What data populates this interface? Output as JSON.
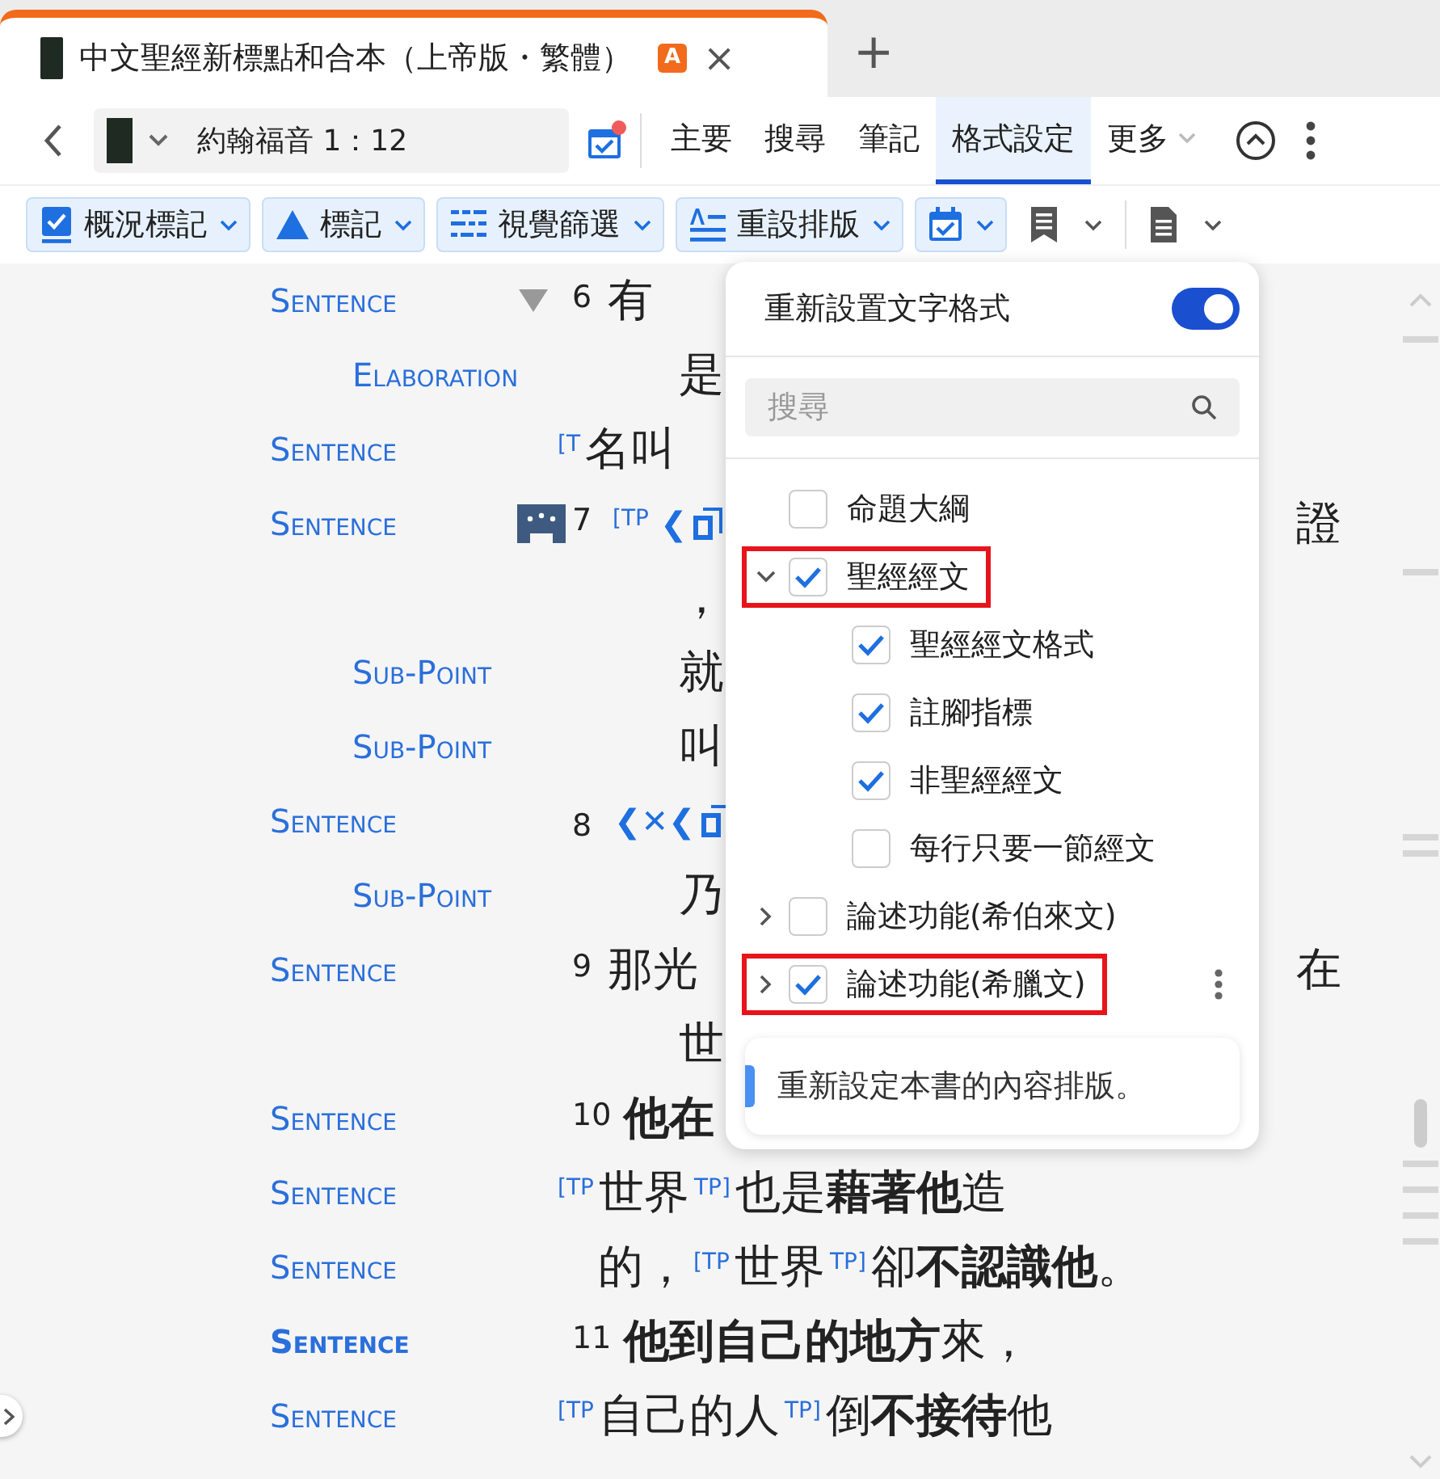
{
  "tab": {
    "title": "中文聖經新標點和合本（上帝版・繁體）",
    "badge": "A",
    "close": "×",
    "add": "+"
  },
  "nav": {
    "reference": "約翰福音 1：12",
    "tabs": [
      {
        "label": "主要",
        "selected": false,
        "dropdown": false
      },
      {
        "label": "搜尋",
        "selected": false,
        "dropdown": false
      },
      {
        "label": "筆記",
        "selected": false,
        "dropdown": false
      },
      {
        "label": "格式設定",
        "selected": true,
        "dropdown": false
      },
      {
        "label": "更多",
        "selected": false,
        "dropdown": true
      }
    ]
  },
  "toolbar": [
    {
      "label": "概況標記",
      "kind": "chip"
    },
    {
      "label": "標記",
      "kind": "chip"
    },
    {
      "label": "視覺篩選",
      "kind": "chip"
    },
    {
      "label": "重設排版",
      "kind": "chip"
    },
    {
      "kind": "chip"
    },
    {
      "kind": "plain"
    },
    {
      "kind": "plain"
    }
  ],
  "rows": [
    {
      "label": "Sentence",
      "bold": false,
      "kind": "verse",
      "segments": [
        {
          "kind": "triangle"
        },
        {
          "kind": "num",
          "text": "6"
        },
        {
          "kind": "text",
          "text": "有"
        }
      ]
    },
    {
      "sub_label": "Elaboration",
      "bold": false,
      "kind": "inner",
      "segments": [
        {
          "kind": "text",
          "text": "是"
        }
      ]
    },
    {
      "label": "Sentence",
      "bold": false,
      "kind": "outer",
      "segments": [
        {
          "kind": "tag",
          "text": "[T"
        },
        {
          "kind": "text",
          "text": "名叫"
        }
      ]
    },
    {
      "label": "Sentence",
      "bold": false,
      "kind": "verse",
      "segments": [
        {
          "kind": "block"
        },
        {
          "kind": "num",
          "text": "7"
        },
        {
          "kind": "tag",
          "text": "[TP"
        },
        {
          "kind": "glyph",
          "text": "❮"
        },
        {
          "kind": "square"
        }
      ],
      "right": "證"
    },
    {
      "kind": "inner",
      "segments": [
        {
          "kind": "text",
          "text": "，"
        }
      ]
    },
    {
      "sub_label": "Sub-Point",
      "bold": false,
      "kind": "inner",
      "segments": [
        {
          "kind": "text",
          "text": "就"
        }
      ]
    },
    {
      "sub_label": "Sub-Point",
      "bold": false,
      "kind": "inner",
      "segments": [
        {
          "kind": "text",
          "text": "叫"
        }
      ]
    },
    {
      "label": "Sentence",
      "bold": false,
      "kind": "verse",
      "segments": [
        {
          "kind": "gap"
        },
        {
          "kind": "num",
          "text": "8"
        },
        {
          "kind": "glyph",
          "text": "❮✕❮"
        },
        {
          "kind": "square"
        }
      ]
    },
    {
      "sub_label": "Sub-Point",
      "bold": false,
      "kind": "inner",
      "segments": [
        {
          "kind": "text",
          "text": "乃"
        }
      ]
    },
    {
      "label": "Sentence",
      "bold": false,
      "kind": "verse",
      "segments": [
        {
          "kind": "gap"
        },
        {
          "kind": "num",
          "text": "9"
        },
        {
          "kind": "text",
          "text": "那光"
        }
      ],
      "right": "在"
    },
    {
      "kind": "inner",
      "segments": [
        {
          "kind": "text",
          "text": "世"
        }
      ]
    },
    {
      "label": "Sentence",
      "bold": false,
      "kind": "verse",
      "segments": [
        {
          "kind": "gap"
        },
        {
          "kind": "num",
          "text": "10"
        },
        {
          "kind": "text",
          "text": "**他在**"
        }
      ]
    },
    {
      "label": "Sentence",
      "bold": false,
      "kind": "outer",
      "segments": [
        {
          "kind": "tag",
          "text": "[TP"
        },
        {
          "kind": "text",
          "text": "世界"
        },
        {
          "kind": "tag",
          "text": "TP]"
        },
        {
          "kind": "text",
          "text": "也是**藉著他**造"
        }
      ]
    },
    {
      "label": "Sentence",
      "bold": false,
      "kind": "middle",
      "segments": [
        {
          "kind": "text",
          "text": "的，"
        },
        {
          "kind": "tag",
          "text": "[TP"
        },
        {
          "kind": "text",
          "text": "世界"
        },
        {
          "kind": "tag",
          "text": "TP]"
        },
        {
          "kind": "text",
          "text": "卻**不認識他**。"
        }
      ]
    },
    {
      "label": "Sentence",
      "bold": true,
      "kind": "verse",
      "segments": [
        {
          "kind": "gap"
        },
        {
          "kind": "num",
          "text": "11"
        },
        {
          "kind": "text",
          "text": "**他到自己的地方**來，"
        }
      ]
    },
    {
      "label": "Sentence",
      "bold": false,
      "kind": "outer",
      "segments": [
        {
          "kind": "tag",
          "text": "[TP"
        },
        {
          "kind": "text",
          "text": "自己的人"
        },
        {
          "kind": "tag",
          "text": "TP]"
        },
        {
          "kind": "text",
          "text": "倒**不接待**他"
        }
      ]
    }
  ],
  "popup": {
    "title": "重新設置文字格式",
    "toggle_on": true,
    "search": {
      "placeholder": "搜尋"
    },
    "items": [
      {
        "label": "命題大綱",
        "checked": false,
        "highlighted": false,
        "hovered": false
      },
      {
        "label": "聖經經文",
        "checked": true,
        "expanded": true,
        "highlighted": true,
        "hovered": false,
        "children": [
          {
            "label": "聖經經文格式",
            "checked": true
          },
          {
            "label": "註腳指標",
            "checked": true
          },
          {
            "label": "非聖經經文",
            "checked": true
          },
          {
            "label": "每行只要一節經文",
            "checked": false
          }
        ]
      },
      {
        "label": "論述功能(希伯來文)",
        "checked": false,
        "expanded": false,
        "highlighted": false,
        "hovered": false
      },
      {
        "label": "論述功能(希臘文)",
        "checked": true,
        "expanded": false,
        "highlighted": true,
        "hovered": true
      }
    ],
    "note": "重新設定本書的內容排版。"
  }
}
